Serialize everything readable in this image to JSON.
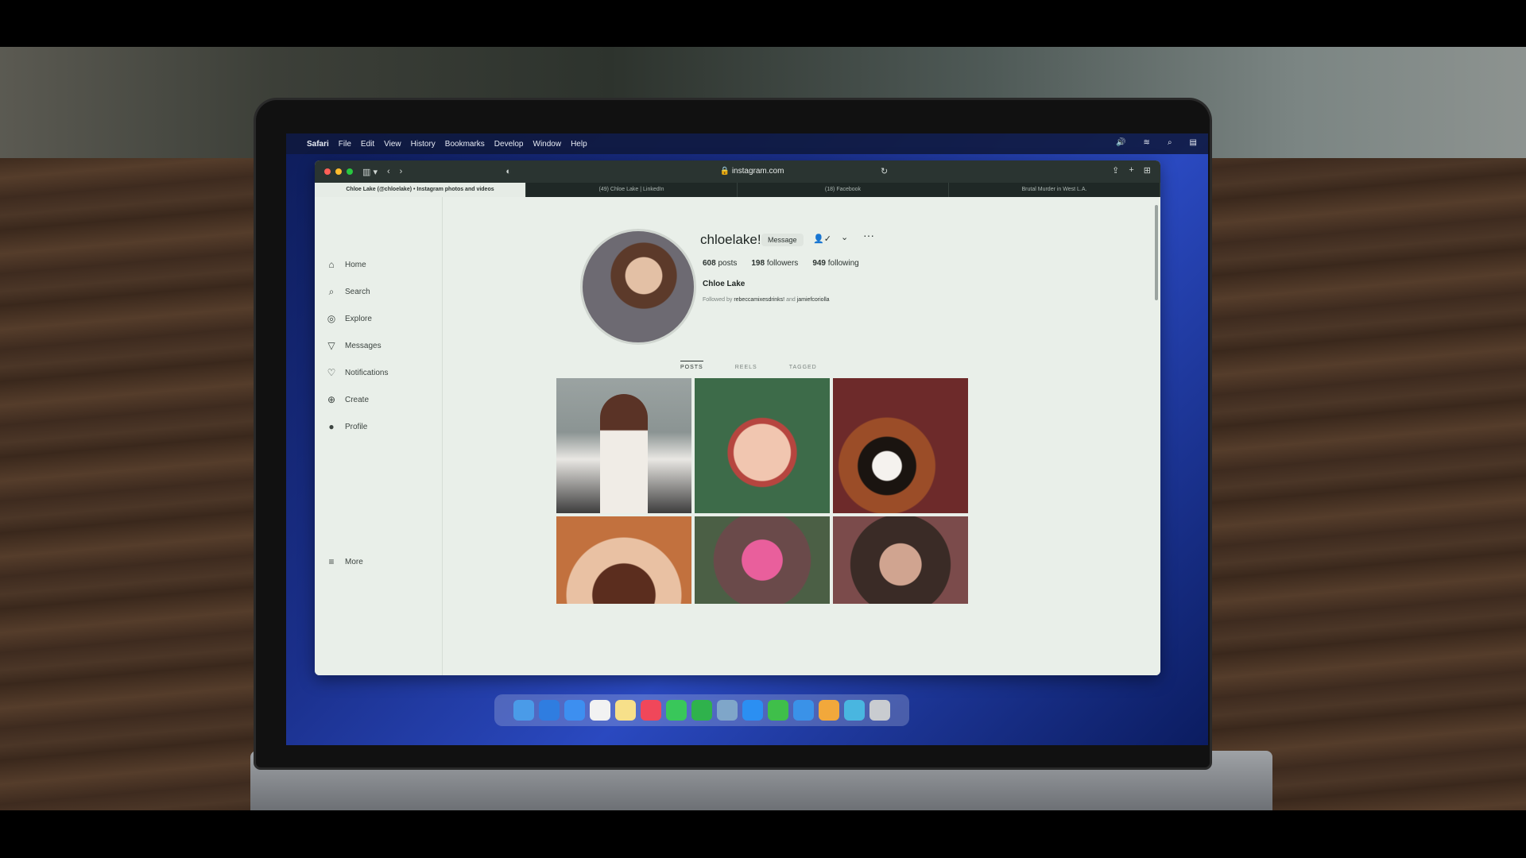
{
  "menubar": {
    "apple": "",
    "app": "Safari",
    "items": [
      "File",
      "Edit",
      "View",
      "History",
      "Bookmarks",
      "Develop",
      "Window",
      "Help"
    ]
  },
  "browser": {
    "url": "instagram.com",
    "tabs": [
      "Chloe Lake (@chloelake) • Instagram photos and videos",
      "(49) Chloe Lake | LinkedIn",
      "(18) Facebook",
      "Brutal Murder in West L.A."
    ]
  },
  "sidebar": {
    "items": [
      {
        "label": "Home",
        "icon": "home-icon"
      },
      {
        "label": "Search",
        "icon": "search-icon"
      },
      {
        "label": "Explore",
        "icon": "compass-icon"
      },
      {
        "label": "Messages",
        "icon": "send-icon"
      },
      {
        "label": "Notifications",
        "icon": "heart-icon"
      },
      {
        "label": "Create",
        "icon": "plus-square-icon"
      },
      {
        "label": "Profile",
        "icon": "avatar-icon"
      }
    ],
    "more": "More"
  },
  "profile": {
    "username": "chloelake!",
    "message_button": "Message",
    "posts": "608",
    "posts_label": "posts",
    "followers": "198",
    "followers_label": "followers",
    "following": "949",
    "following_label": "following",
    "full_name": "Chloe Lake",
    "followed_by_prefix": "Followed by",
    "followed_by_1": "rebeccamixesdrinks!",
    "followed_by_and": "and",
    "followed_by_2": "jamiefcoriolla"
  },
  "post_tabs": [
    "POSTS",
    "REELS",
    "TAGGED"
  ],
  "colors": {
    "browser_toolbar": "#2a3431",
    "page_background": "#e9efe9",
    "dot_red": "#ff5f57",
    "dot_yellow": "#febc2e",
    "dot_green": "#28c840"
  }
}
